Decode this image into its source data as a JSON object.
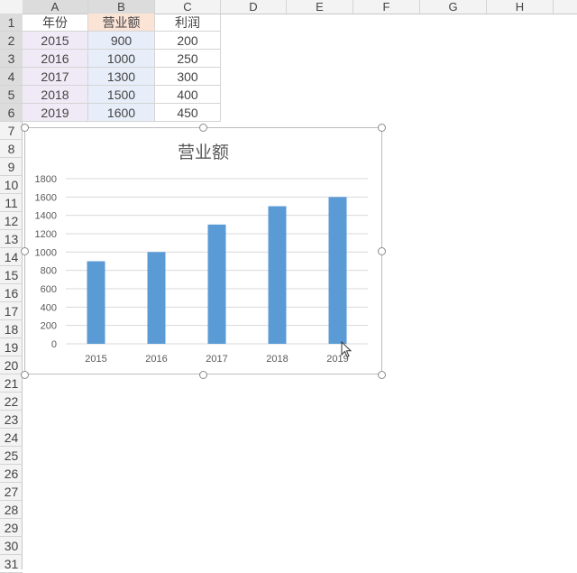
{
  "sheet": {
    "columns": [
      "A",
      "B",
      "C",
      "D",
      "E",
      "F",
      "G",
      "H"
    ],
    "rows": [
      "1",
      "2",
      "3",
      "4",
      "5",
      "6",
      "7",
      "8",
      "9",
      "10",
      "11",
      "12",
      "13",
      "14",
      "15",
      "16",
      "17",
      "18",
      "19",
      "20",
      "21",
      "22",
      "23",
      "24",
      "25",
      "26",
      "27",
      "28",
      "29",
      "30",
      "31"
    ],
    "data": [
      [
        "年份",
        "营业额",
        "利润"
      ],
      [
        "2015",
        "900",
        "200"
      ],
      [
        "2016",
        "1000",
        "250"
      ],
      [
        "2017",
        "1300",
        "300"
      ],
      [
        "2018",
        "1500",
        "400"
      ],
      [
        "2019",
        "1600",
        "450"
      ]
    ]
  },
  "chart_data": {
    "type": "bar",
    "title": "营业额",
    "categories": [
      "2015",
      "2016",
      "2017",
      "2018",
      "2019"
    ],
    "values": [
      900,
      1000,
      1300,
      1500,
      1600
    ],
    "yticks": [
      "0",
      "200",
      "400",
      "600",
      "800",
      "1000",
      "1200",
      "1400",
      "1600",
      "1800"
    ],
    "ylim": [
      0,
      1800
    ],
    "grid": true,
    "bar_color": "#5b9bd5"
  }
}
